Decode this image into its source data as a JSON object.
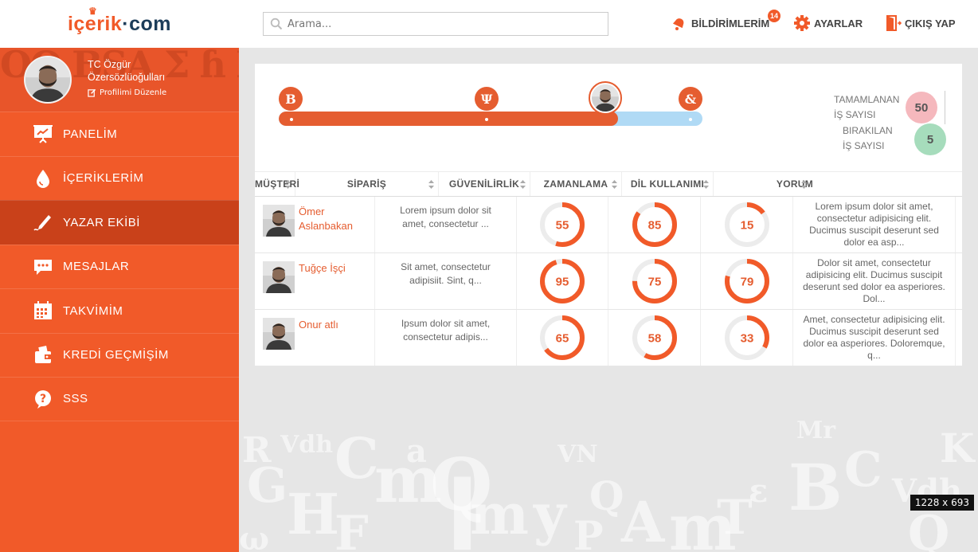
{
  "logo": {
    "part_a": "içerik",
    "dot": "·",
    "part_b": "com"
  },
  "profile": {
    "name": "TC Özgür Özersözlüoğulları",
    "edit_label": "Profilimi Düzenle"
  },
  "nav": [
    {
      "label": "PANELİM",
      "icon": "presentation-chart-icon",
      "active": false
    },
    {
      "label": "İÇERİKLERİM",
      "icon": "drop-icon",
      "active": false
    },
    {
      "label": "YAZAR EKİBİ",
      "icon": "pen-writing-icon",
      "active": true
    },
    {
      "label": "MESAJLAR",
      "icon": "chat-bubble-icon",
      "active": false
    },
    {
      "label": "TAKVİMİM",
      "icon": "calendar-icon",
      "active": false
    },
    {
      "label": "KREDİ GEÇMİŞİM",
      "icon": "wallet-icon",
      "active": false
    },
    {
      "label": "SSS",
      "icon": "question-icon",
      "active": false
    }
  ],
  "topbar": {
    "search_placeholder": "Arama...",
    "notifications_label": "BİLDİRİMLERİM",
    "notifications_count": "14",
    "settings_label": "AYARLAR",
    "logout_label": "ÇIKIŞ YAP"
  },
  "progress": {
    "value": 0.8,
    "stages": [
      {
        "icon": "b-letter-icon",
        "glyph": "B"
      },
      {
        "icon": "psi-letter-icon",
        "glyph": "Ψ"
      },
      {
        "icon": "writer-avatar",
        "glyph": ""
      },
      {
        "icon": "ampersand-letter-icon",
        "glyph": "&"
      }
    ]
  },
  "stats": {
    "completed_label_1": "TAMAMLANAN",
    "completed_label_2": "İŞ SAYISI",
    "completed_value": "50",
    "left_label_1": "BIRAKILAN",
    "left_label_2": "İŞ SAYISI",
    "left_value": "5",
    "completed_color": "#f5b8bd",
    "left_color": "#a6dcbc"
  },
  "table": {
    "headers": [
      "MÜŞTERİ",
      "SİPARİŞ",
      "GÜVENİLİRLİK",
      "ZAMANLAMA",
      "DİL KULLANIMI",
      "YORUM"
    ],
    "rows": [
      {
        "name": "Ömer Aslanbakan",
        "order": "Lorem ipsum dolor sit amet, consectetur ...",
        "scores": [
          55,
          85,
          15
        ],
        "comment": "Lorem ipsum dolor sit amet, consectetur adipisicing elit. Ducimus suscipit deserunt sed dolor ea asp..."
      },
      {
        "name": "Tuğçe İşçi",
        "order": "Sit amet, consectetur adipisiit. Sint, q...",
        "scores": [
          95,
          75,
          79
        ],
        "comment": "Dolor sit amet, consectetur adipisicing elit. Ducimus suscipit deserunt sed dolor ea asperiores. Dol..."
      },
      {
        "name": "Onur atlı",
        "order": "Ipsum dolor sit amet, consectetur adipis...",
        "scores": [
          65,
          58,
          33
        ],
        "comment": "Amet, consectetur adipisicing elit. Ducimus suscipit deserunt sed dolor ea asperiores. Doloremque, q..."
      }
    ]
  },
  "colors": {
    "brand": "#f15a29",
    "brand_dark": "#c9411a",
    "track": "#b0daf5"
  },
  "screen_size_label": "1228 x 693"
}
